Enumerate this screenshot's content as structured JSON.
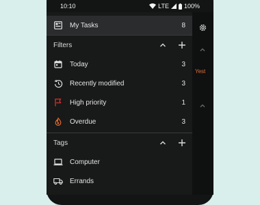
{
  "status": {
    "time": "10:10",
    "network": "LTE",
    "battery": "100%"
  },
  "my_tasks": {
    "label": "My Tasks",
    "count": "8"
  },
  "filters": {
    "title": "Filters",
    "items": [
      {
        "label": "Today",
        "count": "3",
        "icon": "calendar-icon"
      },
      {
        "label": "Recently modified",
        "count": "3",
        "icon": "history-icon"
      },
      {
        "label": "High priority",
        "count": "1",
        "icon": "flag-icon"
      },
      {
        "label": "Overdue",
        "count": "3",
        "icon": "fire-icon"
      }
    ]
  },
  "tags": {
    "title": "Tags",
    "items": [
      {
        "label": "Computer",
        "icon": "laptop-icon"
      },
      {
        "label": "Errands",
        "icon": "truck-icon"
      }
    ]
  },
  "rail": {
    "yesterday_partial": "Yest"
  },
  "colors": {
    "priority_flag": "#d6322f",
    "overdue_fire": "#e36b2d",
    "yest_text": "#e0703a"
  }
}
